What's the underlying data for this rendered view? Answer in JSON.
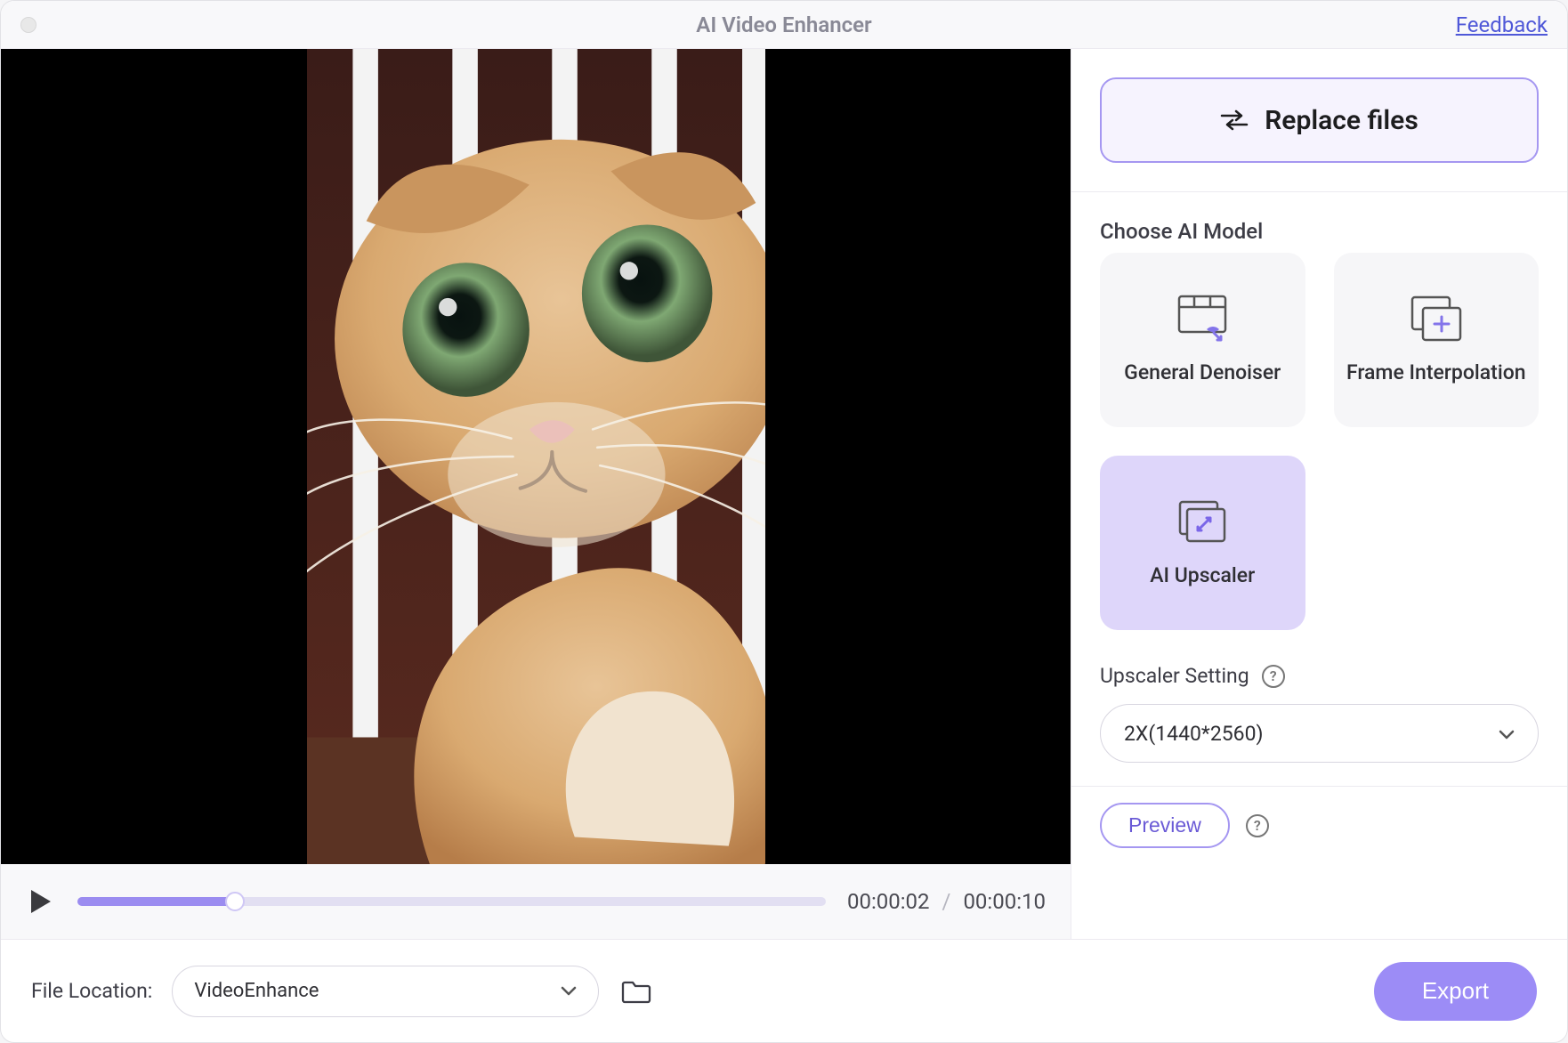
{
  "titlebar": {
    "title": "AI Video Enhancer",
    "feedback": "Feedback"
  },
  "player": {
    "current_time": "00:00:02",
    "total_time": "00:00:10",
    "progress_percent": 21
  },
  "sidebar": {
    "replace_label": "Replace files",
    "choose_model_label": "Choose AI Model",
    "models": [
      {
        "label": "General Denoiser",
        "selected": false
      },
      {
        "label": "Frame Interpolation",
        "selected": false
      },
      {
        "label": "AI Upscaler",
        "selected": true
      }
    ],
    "upscaler_setting_label": "Upscaler Setting",
    "upscaler_value": "2X(1440*2560)",
    "preview_label": "Preview"
  },
  "bottom": {
    "file_location_label": "File Location:",
    "file_location_value": "VideoEnhance",
    "export_label": "Export"
  }
}
